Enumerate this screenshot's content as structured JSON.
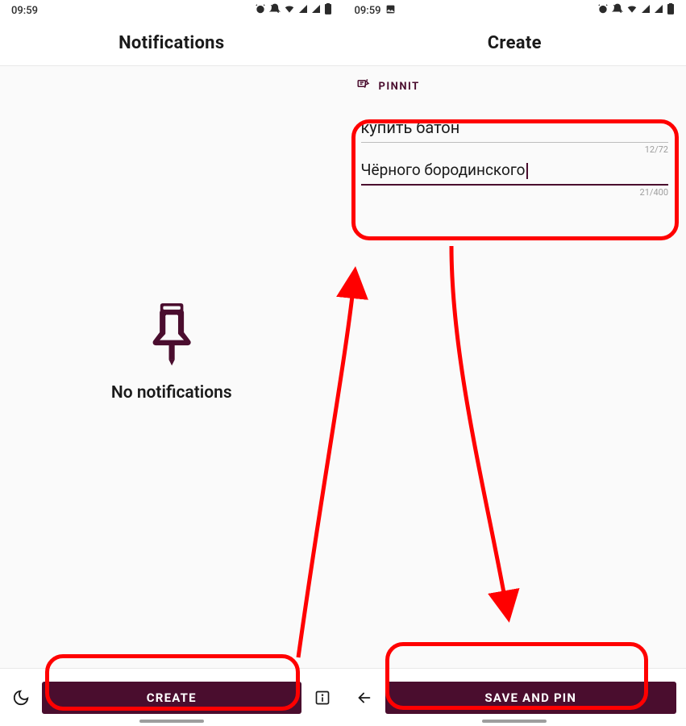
{
  "left": {
    "status_time": "09:59",
    "header_title": "Notifications",
    "empty_text": "No notifications",
    "create_btn": "CREATE"
  },
  "right": {
    "status_time": "09:59",
    "header_title": "Create",
    "brand": "PINNIT",
    "title_value": "купить батон",
    "title_counter": "12/72",
    "body_value": "Чёрного бородинского",
    "body_counter": "21/400",
    "save_btn": "SAVE AND PIN"
  },
  "colors": {
    "primary": "#4a0d2e",
    "annotation": "#ff0000"
  }
}
